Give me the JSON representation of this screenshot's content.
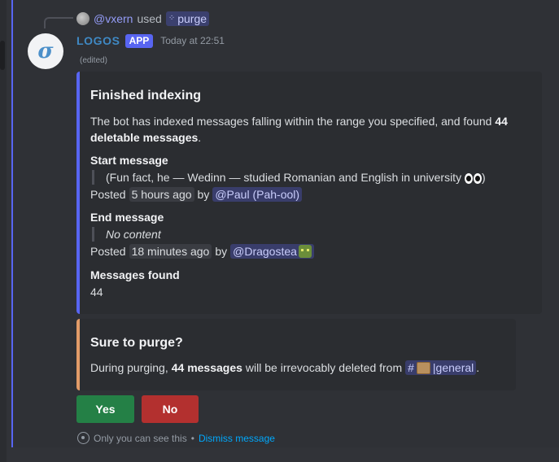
{
  "reply": {
    "user": "@vxern",
    "used": "used",
    "command": "purge"
  },
  "message": {
    "bot_name": "LOGOS",
    "badge": "APP",
    "timestamp": "Today at 22:51",
    "edited": "(edited)"
  },
  "embed1": {
    "title": "Finished indexing",
    "desc_prefix": "The bot has indexed messages falling within the range you specified, and found",
    "desc_count": "44",
    "desc_bold_rest": "deletable messages",
    "desc_suffix": ".",
    "start_label": "Start message",
    "start_quote": "(Fun fact, he — Wedinn — studied Romanian and English in university",
    "start_posted": "Posted",
    "start_time": "5 hours ago",
    "by": "by",
    "start_author": "@Paul (Pah-ool)",
    "end_label": "End message",
    "end_quote": "No content",
    "end_posted": "Posted",
    "end_time": "18 minutes ago",
    "end_author": "@Dragostea",
    "found_label": "Messages found",
    "found_value": "44"
  },
  "embed2": {
    "title": "Sure to purge?",
    "text_prefix": "During purging,",
    "text_bold": "44 messages",
    "text_mid": "will be irrevocably deleted from",
    "channel_hash": "#",
    "channel_name": "|general",
    "text_suffix": "."
  },
  "buttons": {
    "yes": "Yes",
    "no": "No"
  },
  "footer": {
    "only_you": "Only you can see this",
    "sep": "•",
    "dismiss": "Dismiss message"
  },
  "colors": {
    "accent": "#5865f2",
    "warning_accent": "#e29b68",
    "yes": "#248046",
    "no": "#b3302f",
    "bot_name": "#3f89c4"
  },
  "icons": {
    "avatar": "sigma-logo",
    "command": "slash-command-icon",
    "footer": "eye-icon"
  }
}
